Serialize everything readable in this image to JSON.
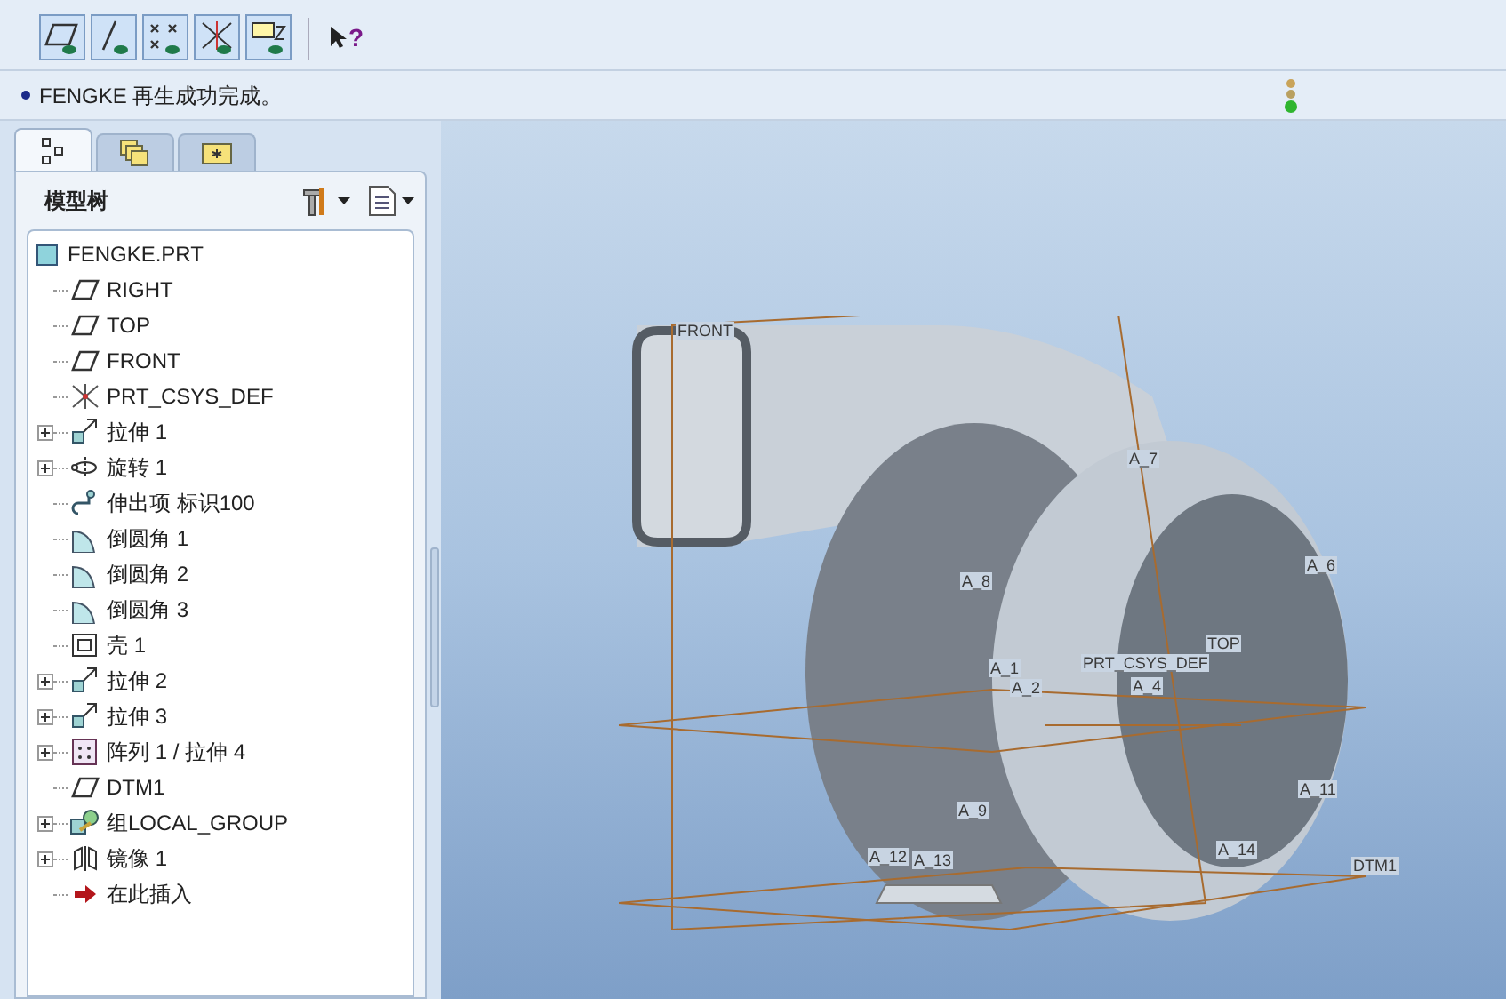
{
  "toolbar": {
    "buttons": [
      {
        "kind": "plane",
        "on": true
      },
      {
        "kind": "axis",
        "on": true
      },
      {
        "kind": "point",
        "on": true
      },
      {
        "kind": "csys",
        "on": true
      },
      {
        "kind": "annotation",
        "on": true
      }
    ],
    "help": {
      "label": "?"
    }
  },
  "message": {
    "text": "FENGKE 再生成功完成。"
  },
  "panel": {
    "tabs": [
      {
        "kind": "tree",
        "selected": true
      },
      {
        "kind": "layers",
        "selected": false
      },
      {
        "kind": "favorites",
        "selected": false
      }
    ],
    "title": "模型树",
    "root": {
      "label": "FENGKE.PRT",
      "children": [
        {
          "label": "RIGHT",
          "kind": "plane",
          "collapsed": false
        },
        {
          "label": "TOP",
          "kind": "plane",
          "collapsed": false
        },
        {
          "label": "FRONT",
          "kind": "plane",
          "collapsed": false
        },
        {
          "label": "PRT_CSYS_DEF",
          "kind": "csys",
          "collapsed": false
        },
        {
          "label": "拉伸 1",
          "kind": "extrude",
          "collapsed": true
        },
        {
          "label": "旋转 1",
          "kind": "revolve",
          "collapsed": true
        },
        {
          "label": "伸出项 标识100",
          "kind": "protrusion",
          "collapsed": false
        },
        {
          "label": "倒圆角 1",
          "kind": "round",
          "collapsed": false
        },
        {
          "label": "倒圆角 2",
          "kind": "round",
          "collapsed": false
        },
        {
          "label": "倒圆角 3",
          "kind": "round",
          "collapsed": false
        },
        {
          "label": "壳 1",
          "kind": "shell",
          "collapsed": false
        },
        {
          "label": "拉伸 2",
          "kind": "extrude",
          "collapsed": true
        },
        {
          "label": "拉伸 3",
          "kind": "extrude",
          "collapsed": true
        },
        {
          "label": "阵列 1 / 拉伸 4",
          "kind": "pattern",
          "collapsed": true
        },
        {
          "label": "DTM1",
          "kind": "plane",
          "collapsed": false
        },
        {
          "label": "组LOCAL_GROUP",
          "kind": "group",
          "collapsed": true
        },
        {
          "label": "镜像 1",
          "kind": "mirror",
          "collapsed": true
        },
        {
          "label": "在此插入",
          "kind": "insert",
          "collapsed": false
        }
      ]
    }
  },
  "viewport": {
    "labels": [
      "FRONT",
      "A_7",
      "A_6",
      "A_8",
      "TOP",
      "A_1",
      "PRT_CSYS_DEF",
      "A_2",
      "A_4",
      "A_11",
      "A_9",
      "A_12",
      "A_13",
      "A_14",
      "DTM1"
    ]
  }
}
